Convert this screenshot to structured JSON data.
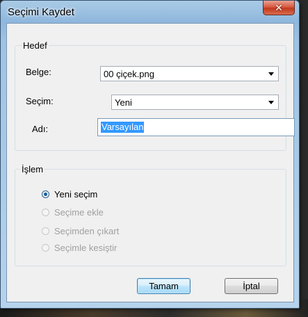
{
  "window": {
    "title": "Seçimi Kaydet",
    "close_glyph": "✕"
  },
  "target": {
    "legend": "Hedef",
    "document_label": "Belge:",
    "document_value": "00 çiçek.png",
    "selection_label": "Seçim:",
    "selection_value": "Yeni",
    "name_label": "Adı:",
    "name_value": "Varsayılan"
  },
  "operation": {
    "legend": "İşlem",
    "options": [
      {
        "label": "Yeni seçim",
        "selected": true,
        "enabled": true
      },
      {
        "label": "Seçime ekle",
        "selected": false,
        "enabled": false
      },
      {
        "label": "Seçimden çıkart",
        "selected": false,
        "enabled": false
      },
      {
        "label": "Seçimle kesiştir",
        "selected": false,
        "enabled": false
      }
    ]
  },
  "buttons": {
    "ok": "Tamam",
    "cancel": "İptal"
  }
}
